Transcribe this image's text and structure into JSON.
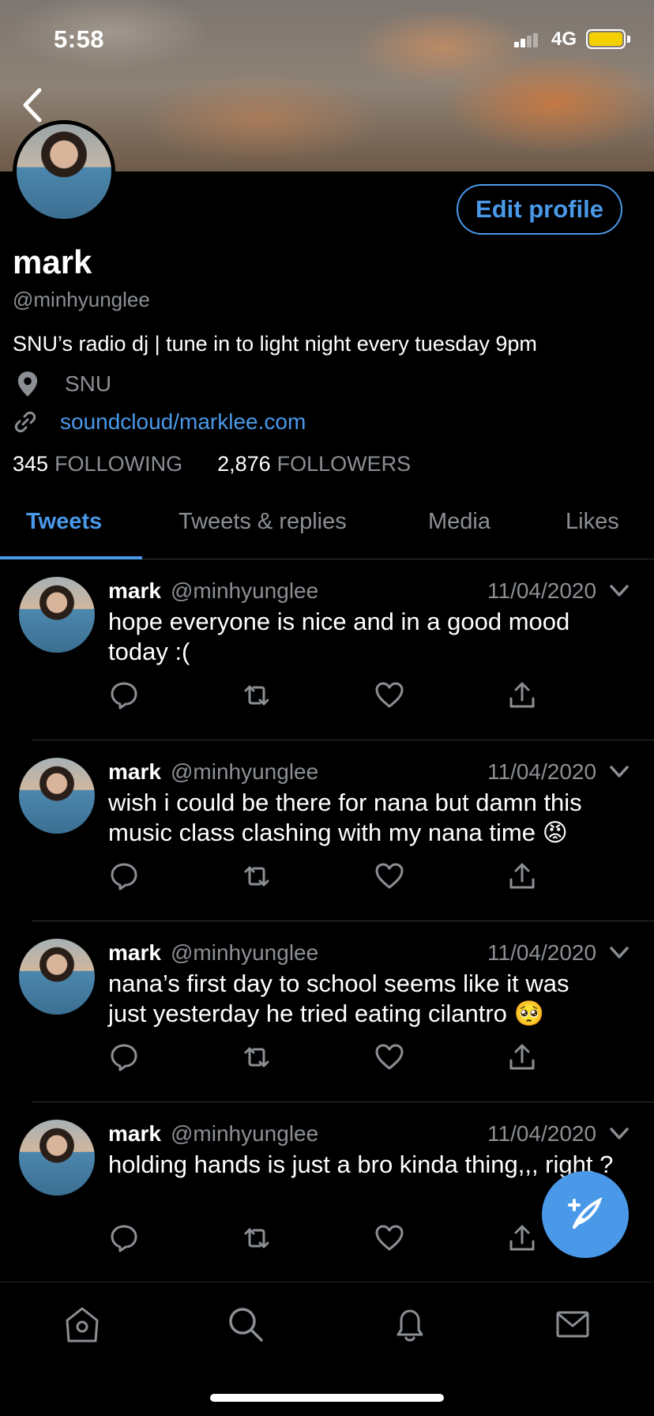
{
  "status_bar": {
    "time": "5:58",
    "network": "4G"
  },
  "profile": {
    "edit_label": "Edit profile",
    "name": "mark",
    "handle": "@minhyunglee",
    "bio": "SNU’s radio dj | tune in to light night every tuesday 9pm",
    "location": "SNU",
    "link": "soundcloud/marklee.com",
    "following_count": "345",
    "following_label": "FOLLOWING",
    "followers_count": "2,876",
    "followers_label": "FOLLOWERS"
  },
  "tabs": [
    {
      "label": "Tweets",
      "active": true
    },
    {
      "label": "Tweets & replies",
      "active": false
    },
    {
      "label": "Media",
      "active": false
    },
    {
      "label": "Likes",
      "active": false
    }
  ],
  "tweets": [
    {
      "name": "mark",
      "handle": "@minhyunglee",
      "date": "11/04/2020",
      "text": "hope everyone is nice and in a good mood today :("
    },
    {
      "name": "mark",
      "handle": "@minhyunglee",
      "date": "11/04/2020",
      "text": "wish i could be there for nana but damn this music class clashing with my nana time 😡"
    },
    {
      "name": "mark",
      "handle": "@minhyunglee",
      "date": "11/04/2020",
      "text": "nana’s first day to school seems like it was just yesterday he tried eating cilantro 🥺"
    },
    {
      "name": "mark",
      "handle": "@minhyunglee",
      "date": "11/04/2020",
      "text": "holding hands is just a bro kinda thing,,, right ?"
    }
  ],
  "colors": {
    "accent": "#4a99e9",
    "muted": "#8b8f94",
    "background": "#000000"
  },
  "icons": {
    "back": "chevron-left-icon",
    "location": "location-pin-icon",
    "link": "link-icon",
    "reply": "reply-icon",
    "retweet": "retweet-icon",
    "like": "heart-icon",
    "share": "share-icon",
    "compose": "compose-tweet-icon",
    "home": "home-icon",
    "search": "search-icon",
    "notifications": "bell-icon",
    "messages": "mail-icon"
  }
}
